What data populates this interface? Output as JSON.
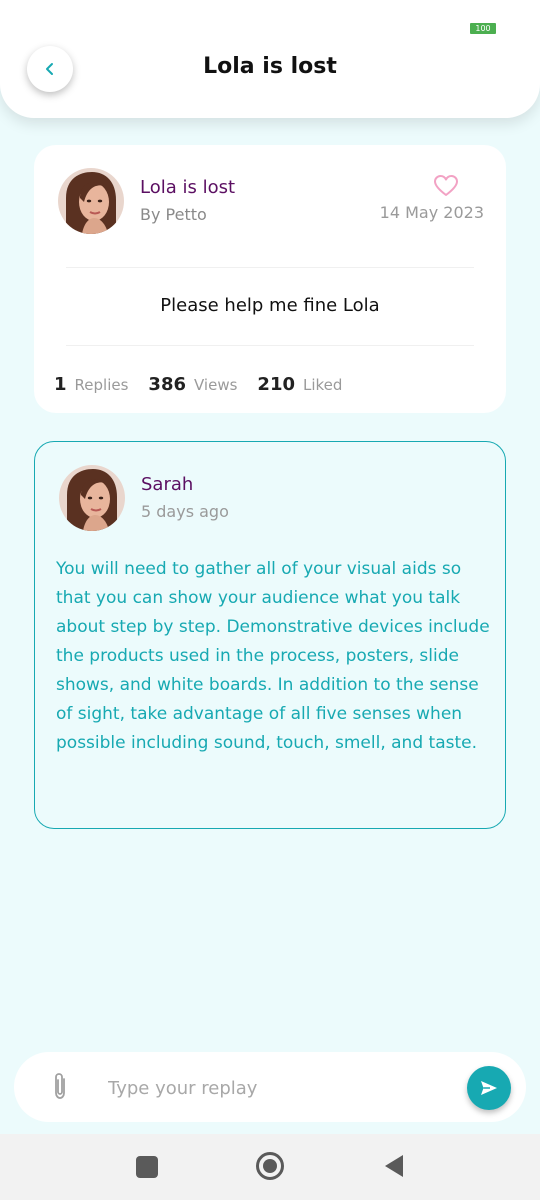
{
  "status_bar": {
    "battery": "100"
  },
  "header": {
    "title": "Lola is lost",
    "back_icon": "chevron-left-icon"
  },
  "post": {
    "title": "Lola is lost",
    "author": "By Petto",
    "date": "14 May 2023",
    "body": "Please help me fine Lola",
    "stats": [
      {
        "value": "1",
        "label": "Replies"
      },
      {
        "value": "386",
        "label": "Views"
      },
      {
        "value": "210",
        "label": "Liked"
      }
    ],
    "like_icon": "heart-outline-icon"
  },
  "reply": {
    "name": "Sarah",
    "time": "5 days ago",
    "text": "You will need to gather all of your visual aids so that you can show your audience what you talk about step by step. Demonstrative devices include the products used in the process, posters, slide shows, and white boards. In addition to the sense of sight, take advantage of all five senses when possible including sound, touch, smell, and taste."
  },
  "composer": {
    "placeholder": "Type your replay",
    "attach_icon": "paperclip-icon",
    "send_icon": "send-icon"
  },
  "colors": {
    "accent": "#17a9b2",
    "name_purple": "#5b0f62",
    "background": "#ecfbfc"
  }
}
